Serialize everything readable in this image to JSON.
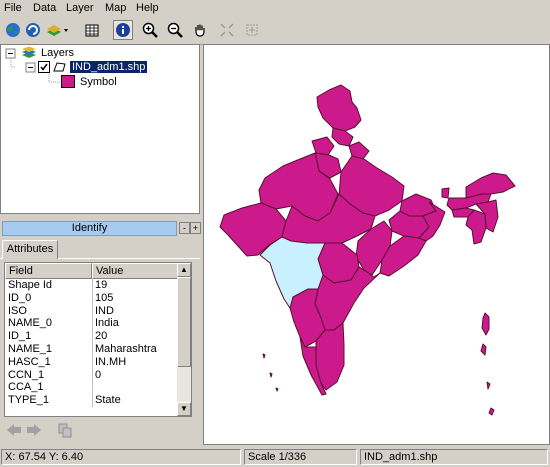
{
  "menu": [
    "File",
    "Data",
    "Layer",
    "Map",
    "Help"
  ],
  "toc": {
    "root_label": "Layers",
    "layer_label": "IND_adm1.shp",
    "symbol_label": "Symbol",
    "layer_color": "#cc1a8c"
  },
  "identify": {
    "title": "Identify",
    "minus": "-",
    "plus": "+",
    "tab": "Attributes"
  },
  "grid": {
    "headers": [
      "Field",
      "Value"
    ],
    "rows": [
      [
        "Shape Id",
        "19"
      ],
      [
        "ID_0",
        "105"
      ],
      [
        "ISO",
        "IND"
      ],
      [
        "NAME_0",
        "India"
      ],
      [
        "ID_1",
        "20"
      ],
      [
        "NAME_1",
        "Maharashtra"
      ],
      [
        "HASC_1",
        "IN.MH"
      ],
      [
        "CCN_1",
        "0"
      ],
      [
        "CCA_1",
        ""
      ],
      [
        "TYPE_1",
        "State"
      ]
    ]
  },
  "status": {
    "coords": "X: 67.54 Y: 6.40",
    "scale": "Scale 1/336",
    "file": "IND_adm1.shp"
  },
  "colors": {
    "state_fill": "#cc1a8c",
    "state_border": "#5a1030",
    "selected_fill": "#c8f0ff"
  }
}
